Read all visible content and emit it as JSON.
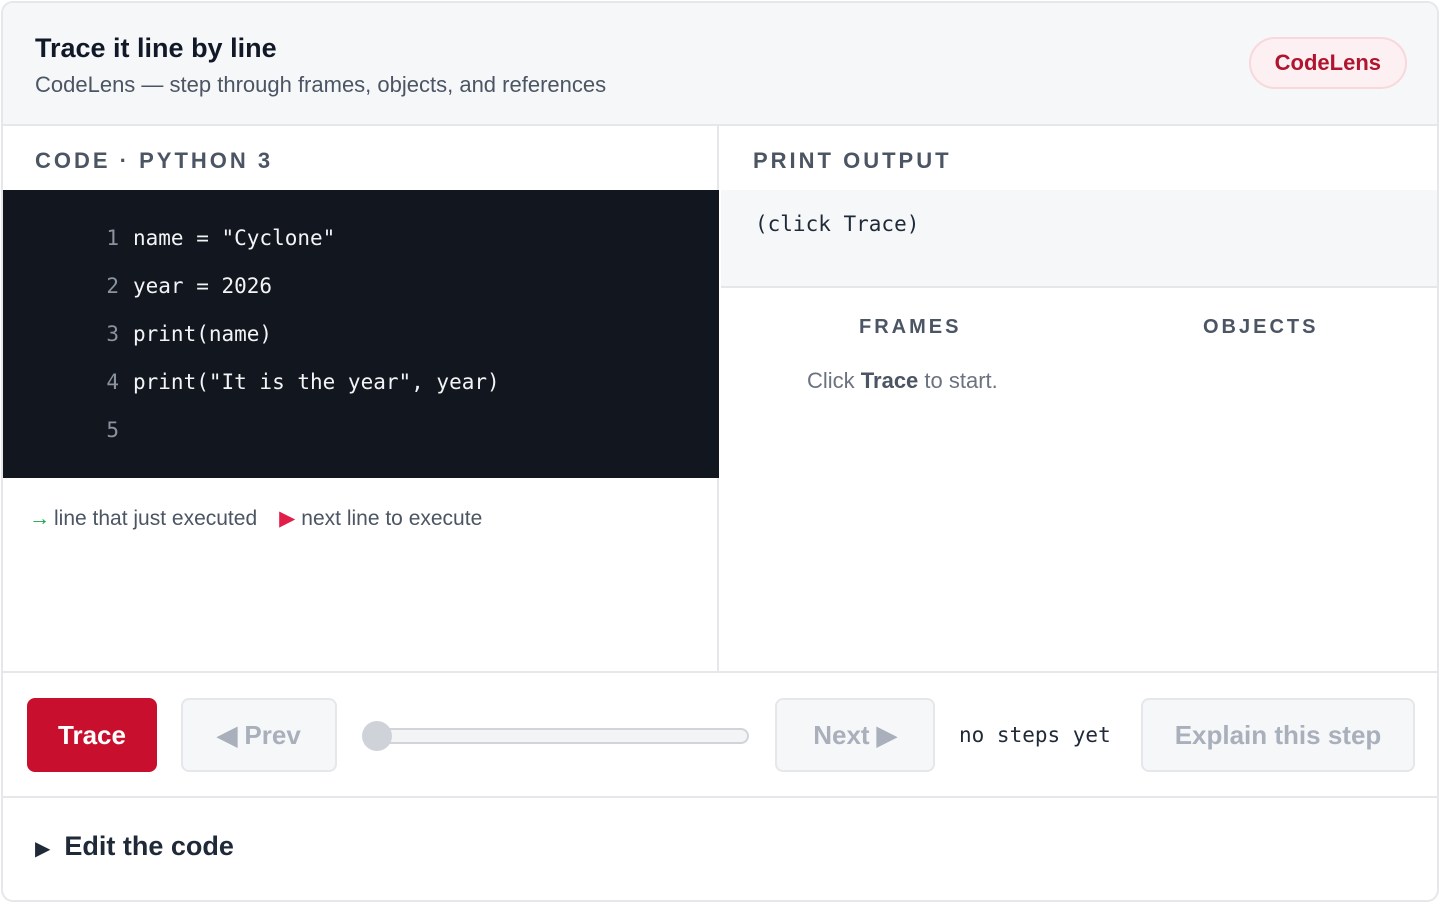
{
  "header": {
    "title": "Trace it line by line",
    "subtitle": "CodeLens — step through frames, objects, and references",
    "badge": "CodeLens"
  },
  "code_panel": {
    "label": "CODE · PYTHON 3",
    "lines": [
      {
        "num": "1",
        "text": "name = \"Cyclone\""
      },
      {
        "num": "2",
        "text": "year = 2026"
      },
      {
        "num": "3",
        "text": "print(name)"
      },
      {
        "num": "4",
        "text": "print(\"It is the year\", year)"
      },
      {
        "num": "5",
        "text": ""
      }
    ],
    "legend": {
      "executed_icon": "→",
      "executed_label": "line that just executed",
      "next_icon": "▶",
      "next_label": "next line to execute"
    }
  },
  "output_panel": {
    "label": "PRINT OUTPUT",
    "text": "(click Trace)",
    "frames_label": "FRAMES",
    "objects_label": "OBJECTS",
    "hint_prefix": "Click",
    "hint_bold": "Trace",
    "hint_suffix": "to start."
  },
  "controls": {
    "trace_label": "Trace",
    "prev_label": "◀ Prev",
    "next_label": "Next ▶",
    "steps_text": "no steps yet",
    "explain_label": "Explain this step",
    "slider_value": 0
  },
  "editor": {
    "toggle_icon": "▶",
    "label": "Edit the code"
  },
  "colors": {
    "accent": "#c8102e",
    "code_bg": "#12161f",
    "executed_arrow": "#16a34a",
    "next_arrow": "#e11d48"
  }
}
